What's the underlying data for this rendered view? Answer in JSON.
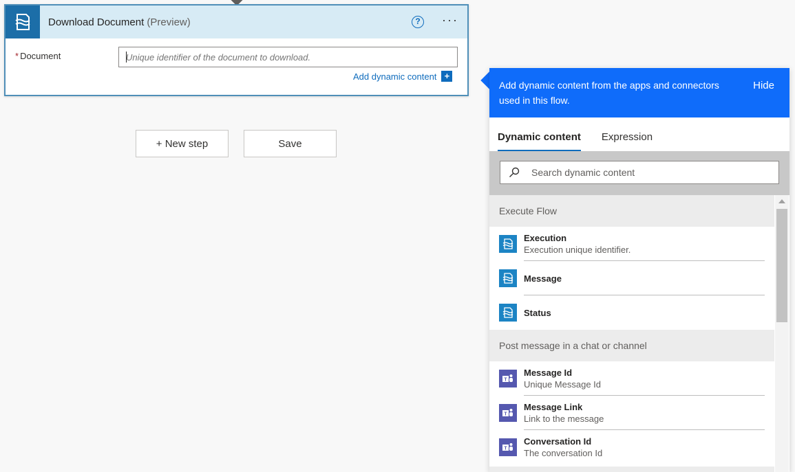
{
  "card": {
    "title": "Download Document",
    "preview": "(Preview)",
    "help": "?",
    "more": "···",
    "field_label": "Document",
    "required_mark": "*",
    "input_placeholder": "Unique identifier of the document to download.",
    "add_dynamic": "Add dynamic content",
    "plus": "+"
  },
  "buttons": {
    "new_step": "+ New step",
    "save": "Save"
  },
  "panel": {
    "message": "Add dynamic content from the apps and connectors used in this flow.",
    "hide": "Hide",
    "tabs": [
      "Dynamic content",
      "Expression"
    ],
    "search_placeholder": "Search dynamic content",
    "groups": [
      {
        "name": "Execute Flow",
        "items": [
          {
            "title": "Execution",
            "desc": "Execution unique identifier."
          },
          {
            "title": "Message",
            "desc": ""
          },
          {
            "title": "Status",
            "desc": ""
          }
        ]
      },
      {
        "name": "Post message in a chat or channel",
        "items": [
          {
            "title": "Message Id",
            "desc": "Unique Message Id"
          },
          {
            "title": "Message Link",
            "desc": "Link to the message"
          },
          {
            "title": "Conversation Id",
            "desc": "The conversation Id"
          }
        ]
      }
    ]
  },
  "colors": {
    "accent": "#0f6cfa",
    "link": "#0f6cbd",
    "flow_icon": "#1c84c4",
    "teams_icon": "#5558af"
  },
  "icons": {
    "card": "document-flow-icon",
    "help": "help-circle-icon",
    "more": "more-dots-icon",
    "search": "search-icon",
    "flow": "execute-flow-icon",
    "teams": "teams-icon"
  }
}
